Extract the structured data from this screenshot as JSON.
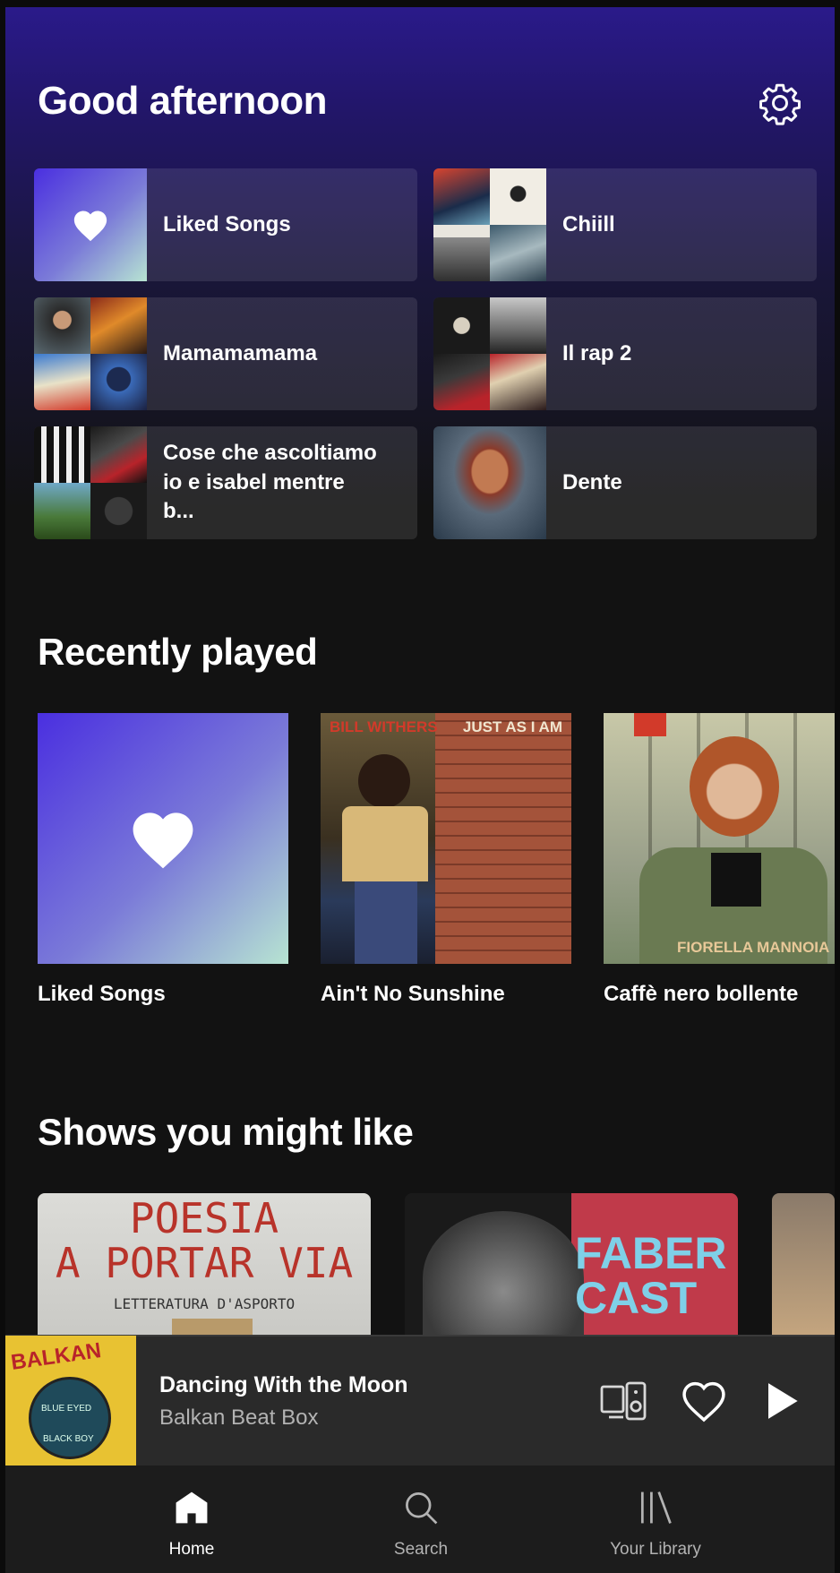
{
  "header": {
    "greeting": "Good afternoon"
  },
  "quick_tiles": [
    {
      "label": "Liked Songs"
    },
    {
      "label": "Chiill"
    },
    {
      "label": "Mamamamama"
    },
    {
      "label": "Il rap 2"
    },
    {
      "label": "Cose che ascoltiamo io e isabel mentre b..."
    },
    {
      "label": "Dente"
    }
  ],
  "recently_played": {
    "title": "Recently played",
    "items": [
      {
        "label": "Liked Songs"
      },
      {
        "label": "Ain't No Sunshine",
        "cover_text_1": "BILL WITHERS",
        "cover_text_2": "JUST AS I AM"
      },
      {
        "label": "Caffè nero bollente",
        "cover_text": "FIORELLA MANNOIA"
      }
    ]
  },
  "shows": {
    "title": "Shows you might like",
    "items": [
      {
        "cover_line_1": "POESIA",
        "cover_line_2": "A PORTAR VIA",
        "cover_line_3": "LETTERATURA D'ASPORTO"
      },
      {
        "cover_line_1": "FABER",
        "cover_line_2": "CAST"
      },
      {
        "cover_line_1": ""
      }
    ]
  },
  "now_playing": {
    "title": "Dancing With the Moon",
    "artist": "Balkan Beat Box",
    "cover_text_top": "BALKAN",
    "cover_text_mid": "BLUE EYED",
    "cover_text_bot": "BLACK BOY"
  },
  "tabs": [
    {
      "label": "Home",
      "icon": "home-icon",
      "active": true
    },
    {
      "label": "Search",
      "icon": "search-icon",
      "active": false
    },
    {
      "label": "Your Library",
      "icon": "library-icon",
      "active": false
    }
  ],
  "colors": {
    "background": "#121212",
    "header_gradient_top": "#2a1a8a",
    "tile_bg": "#2a2a2a",
    "liked_gradient_start": "#4a2fe0",
    "liked_gradient_end": "#b7e4d2",
    "secondary_text": "#b3b3b3",
    "player_bg": "#2a2a2a"
  }
}
